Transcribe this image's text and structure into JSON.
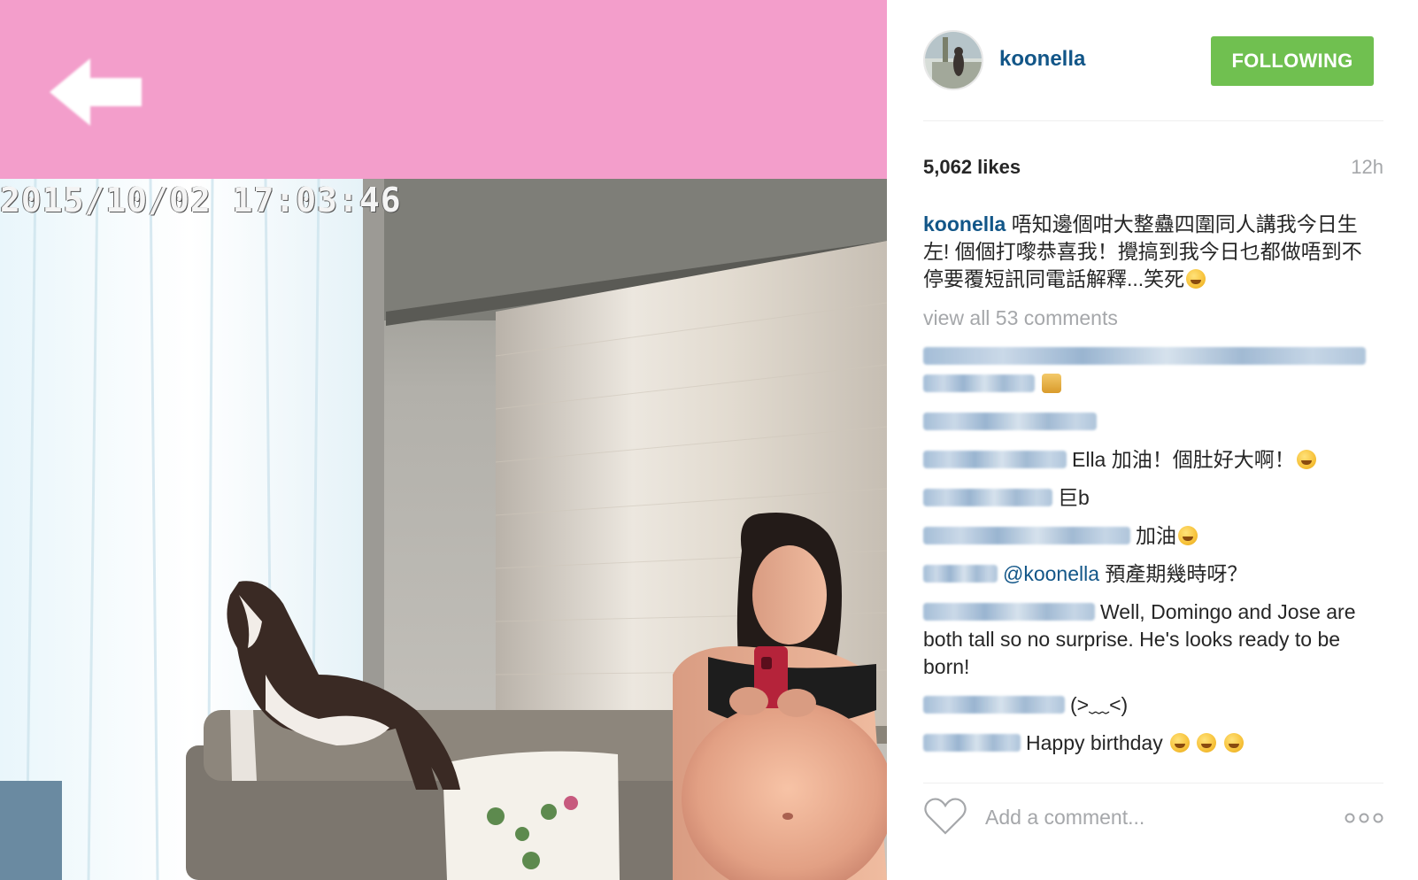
{
  "photo": {
    "timestamp": "2015/10/02 17:03:46",
    "bar_color": "#f39ecb",
    "back_icon": "back-arrow-icon"
  },
  "header": {
    "username": "koonella",
    "follow_label": "FOLLOWING",
    "follow_color": "#70c050"
  },
  "stats": {
    "likes": "5,062 likes",
    "time_ago": "12h"
  },
  "caption": {
    "user": "koonella",
    "text": "唔知邊個咁大整蠱四圍同人講我今日生左! 個個打嚟恭喜我！攪搞到我今日乜都做唔到不停要覆短訊同電話解釋...笑死"
  },
  "view_all": "view all 53 comments",
  "comments": [
    {
      "text": "Ella 加油！個肚好大啊！"
    },
    {
      "text": "巨b"
    },
    {
      "text": "加油"
    },
    {
      "mention": "@koonella",
      "text": " 預產期幾時呀？"
    },
    {
      "text": "Well, Domingo and Jose are both tall so no surprise. He's looks ready to be born!"
    },
    {
      "text": "(>﹏<)"
    },
    {
      "text": "Happy birthday"
    }
  ],
  "footer": {
    "comment_placeholder": "Add a comment...",
    "heart_icon": "heart-icon",
    "more_icon": "more-options-icon"
  }
}
